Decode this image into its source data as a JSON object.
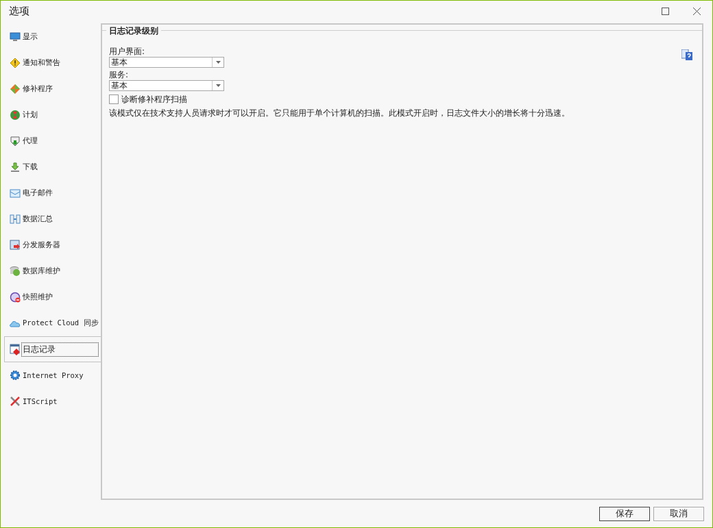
{
  "window": {
    "title": "选项"
  },
  "sidebar": {
    "items": [
      {
        "label": "显示",
        "selected": false
      },
      {
        "label": "通知和警告",
        "selected": false
      },
      {
        "label": "修补程序",
        "selected": false
      },
      {
        "label": "计划",
        "selected": false
      },
      {
        "label": "代理",
        "selected": false
      },
      {
        "label": "下载",
        "selected": false
      },
      {
        "label": "电子邮件",
        "selected": false
      },
      {
        "label": "数据汇总",
        "selected": false
      },
      {
        "label": "分发服务器",
        "selected": false
      },
      {
        "label": "数据库维护",
        "selected": false
      },
      {
        "label": "快照维护",
        "selected": false
      },
      {
        "label": "Protect Cloud 同步",
        "selected": false
      },
      {
        "label": "日志记录",
        "selected": true
      },
      {
        "label": "Internet Proxy",
        "selected": false
      },
      {
        "label": "ITScript",
        "selected": false
      }
    ]
  },
  "panel": {
    "group_title": "日志记录级别",
    "fields": [
      {
        "label": "用户界面:",
        "value": "基本"
      },
      {
        "label": "服务:",
        "value": "基本"
      }
    ],
    "checkbox": {
      "label": "诊断修补程序扫描",
      "checked": false
    },
    "note": "该模式仅在技术支持人员请求时才可以开启。它只能用于单个计算机的扫描。此模式开启时，日志文件大小的增长将十分迅速。"
  },
  "buttons": [
    {
      "label": "保存",
      "kind": "primary"
    },
    {
      "label": "取消",
      "kind": "secondary"
    }
  ]
}
